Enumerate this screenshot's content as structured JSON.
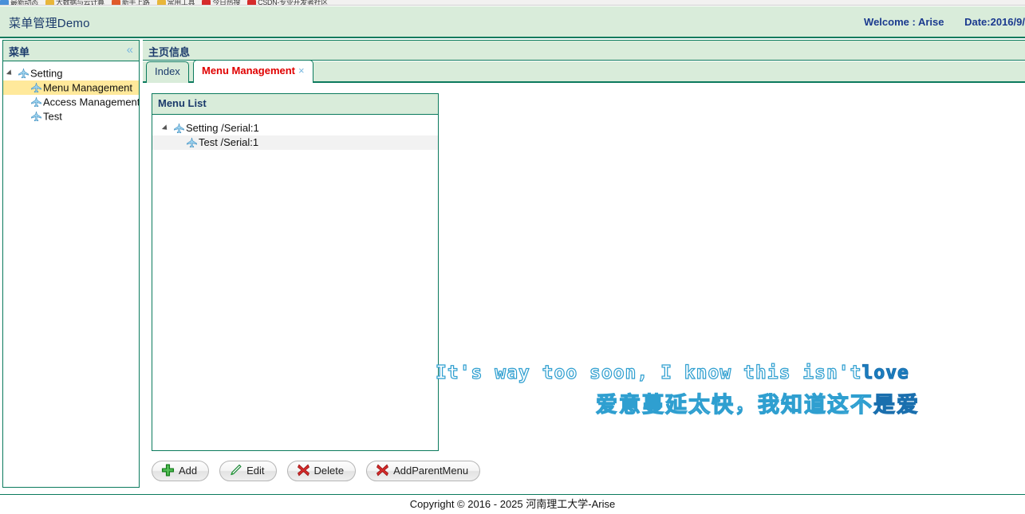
{
  "browser_bookmarks_sliver": {
    "visible_fragment": true,
    "items": [
      {
        "label": "最新动态",
        "icon_color": "#4a90d9"
      },
      {
        "label": "大数据与云计算",
        "icon_color": "#e8b63a"
      },
      {
        "label": "新手上路",
        "icon_color": "#e05a2b"
      },
      {
        "label": "常用工具",
        "icon_color": "#e8b63a"
      },
      {
        "label": "今日热搜",
        "icon_color": "#d62b2b"
      },
      {
        "label": "CSDN-专业开发者社区",
        "icon_color": "#d62b2b"
      }
    ]
  },
  "header": {
    "title": "菜单管理Demo",
    "welcome": "Welcome : Arise",
    "date": "Date:2016/9/"
  },
  "sidebar": {
    "title": "菜单",
    "collapse_icon": "chevron-double-left-icon",
    "tree": [
      {
        "label": "Setting",
        "level": 1,
        "expanded": true,
        "selected": false,
        "icon": "plane-icon"
      },
      {
        "label": "Menu Management",
        "level": 2,
        "expanded": false,
        "selected": true,
        "icon": "plane-icon"
      },
      {
        "label": "Access Management",
        "level": 2,
        "expanded": false,
        "selected": false,
        "icon": "plane-icon"
      },
      {
        "label": "Test",
        "level": 2,
        "expanded": false,
        "selected": false,
        "icon": "plane-icon"
      }
    ]
  },
  "content": {
    "title": "主页信息",
    "tabs": [
      {
        "label": "Index",
        "active": false,
        "closable": false
      },
      {
        "label": "Menu Management",
        "active": true,
        "closable": true,
        "close_icon": "close-x-icon"
      }
    ]
  },
  "menu_panel": {
    "title": "Menu List",
    "tree": [
      {
        "label": "Setting /Serial:1",
        "level": 1,
        "expanded": true,
        "hovered": false,
        "icon": "plane-icon"
      },
      {
        "label": "Test /Serial:1",
        "level": 2,
        "expanded": false,
        "hovered": true,
        "icon": "plane-icon"
      }
    ]
  },
  "buttons": [
    {
      "label": "Add",
      "icon": "green-plus-icon"
    },
    {
      "label": "Edit",
      "icon": "pencil-icon"
    },
    {
      "label": "Delete",
      "icon": "red-x-icon"
    },
    {
      "label": "AddParentMenu",
      "icon": "red-x-icon"
    }
  ],
  "lyric_overlay": {
    "english": {
      "unsung": "It's way too soon, I know this isn't",
      "sung": "love"
    },
    "chinese": {
      "unsung": "爱意蔓延太快，我知道这不",
      "sung": "是爱"
    },
    "colors": {
      "unsung_fill": "#ffffff",
      "unsung_outline": "#2f9fd0",
      "sung_fill": "#1a7fc1"
    }
  },
  "footer": {
    "text": "Copyright © 2016 - 2025 河南理工大学-Arise"
  },
  "theme": {
    "panel_header_bg": "#d9ecda",
    "border_green": "#0b7a5d",
    "title_navy": "#1b3a6b",
    "selected_yellow": "#ffe99b",
    "active_tab_red": "#e00000",
    "icon_blue": "#79b8e0"
  }
}
